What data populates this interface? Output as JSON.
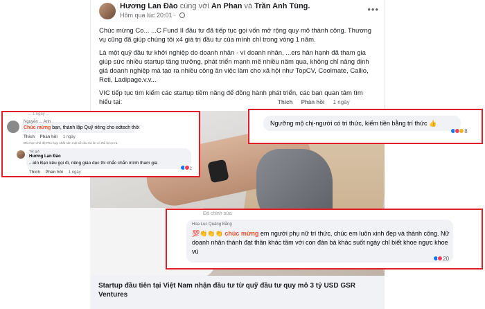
{
  "post": {
    "author": "Hương Lan Đào",
    "with_word": "cùng với",
    "tagged1": "An Phan",
    "and_word": "và",
    "tagged2": "Trần Anh Tùng.",
    "time": "Hôm qua lúc 20:01 ·",
    "paragraphs": [
      "Chúc mừng Co... ...C Fund II đầu tư đã tiếp tục gọi vốn mở rộng quy mô thành công. Thương vụ cũng đã giúp chúng tôi x4 giá trị đầu tư của mình chỉ trong vòng 1 năm.",
      "Là một quỹ đầu tư khởi nghiệp do doanh nhân - vì doanh nhân, ...ers hân hạnh đã tham gia giúp sức nhiều startup tăng trưởng, phát triển mạnh mẽ nhiều năm qua, không chỉ nâng định giá doanh nghiệp mà tạo ra nhiều công ăn việc làm cho xã hội như TopCV, Coolmate, Callio, Reti, Ladipage.v.v...",
      "VIC tiếp tục tìm kiếm các startup tiềm năng để đồng hành phát triển, các bạn quan tâm tìm hiểu tại:"
    ],
    "actions": {
      "like": "Thích",
      "reply": "Phản hồi",
      "time": "1 ngày"
    },
    "caption": "Startup đầu tiên tại Việt Nam nhận đầu tư từ quỹ đầu tư quy mô 3 tỷ USD GSR Ventures"
  },
  "comment_left": {
    "faded_top": "... 1 ngày ...",
    "commenter": "Nguyễn ... Anh",
    "highlight": "Chúc mừng",
    "text": " bạn, thành lập Quỹ riêng cho edtech thôi",
    "actions": {
      "like": "Thích",
      "reply": "Phản hồi",
      "time": "1 ngày"
    },
    "reply_note": "Đã chọn chế độ Phù hợp nhất nên một số câu trả lời có thể bị lọc ra.",
    "reply_author_tag": "Tác giả",
    "reply_name": "Hương Lan Đào",
    "reply_text": "...iến Bạn kêu gọi đi, riêng giáo dục thì chắc chắn mình tham gia",
    "reply_actions": {
      "like": "Thích",
      "reply": "Phản hồi",
      "time": "1 ngày"
    },
    "reply_reactions": "2"
  },
  "comment_top_right": {
    "text": "Ngưỡng mộ chị-người có tri thức, kiếm tiền bằng trí thức 👍",
    "reactions": "8"
  },
  "comment_bottom_right": {
    "faded_top": "Đã chỉnh sửa",
    "commenter": "Hoa Lục Quảng Bằng",
    "emoji": "💯👏👏👏",
    "highlight": "chúc mừng",
    "text": " em người phụ nữ trí thức, chúc em luôn xinh đẹp và thành công. Nữ doanh nhân thành đạt thần khác tầm với con đàn bà khác suốt ngày chỉ biết khoe ngực khoe vú",
    "reactions": "20"
  }
}
